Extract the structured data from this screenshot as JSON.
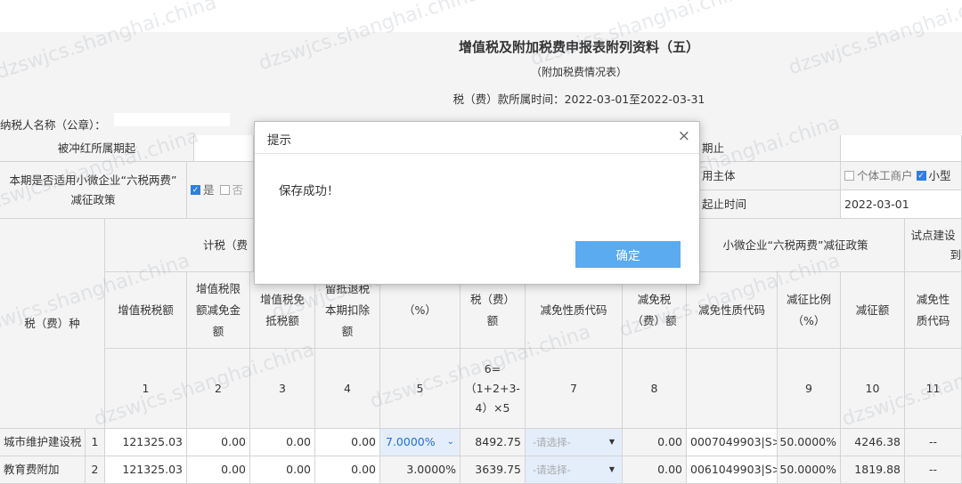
{
  "header": {
    "title": "增值税及附加税费申报表附列资料（五）",
    "subtitle": "（附加税费情况表）",
    "period": "税（费）款所属时间：2022-03-01至2022-03-31",
    "taxpayer_label": "纳税人名称（公章）："
  },
  "info": {
    "red_period_start_label": "被冲红所属期起",
    "red_period_end_label": "期止",
    "small_policy_label_1": "本期是否适用小微企业“六税两费”",
    "small_policy_label_2": "减征政策",
    "yes_label": "是",
    "no_label": "否",
    "subject_label": "用主体",
    "individual_label": "个体工商户",
    "small_label": "小型",
    "start_time_label": "起止时间",
    "start_time_value": "2022-03-01"
  },
  "columns": {
    "tax_type": "税（费）种",
    "calc_group": "计税（费",
    "small_group": "小微企业“六税两费”减征政策",
    "pilot_group": "试点建设",
    "pilot_group_2": "到",
    "vat_amount": "增值税税额",
    "limit_reduction": "增值税限额减免金额",
    "exempt_offset": "增值税免抵税额",
    "refund_deduction": "留抵退税本期扣除额",
    "rate": "（%）",
    "tax_amount": "税（费）额",
    "exempt_code": "减免性质代码",
    "exempt_amount": "减免税（费）额",
    "reduction_code": "减免性质代码",
    "reduction_ratio": "减征比例（%）",
    "reduction_amount": "减征额",
    "pilot_code": "减免性质代码"
  },
  "col_numbers": [
    "1",
    "2",
    "3",
    "4",
    "5",
    "6=（1+2+3-4）×5",
    "7",
    "8",
    "9",
    "10",
    "11"
  ],
  "rows": [
    {
      "name": "城市维护建设税",
      "no": "1",
      "vat": "121325.03",
      "limit": "0.00",
      "offset": "0.00",
      "refund": "0.00",
      "rate": "7.0000%",
      "tax": "8492.75",
      "exempt_code": "-请选择-",
      "exempt_amount": "0.00",
      "reduction_code": "0007049903|S>",
      "ratio": "50.0000%",
      "reduction": "4246.38",
      "pilot": "--"
    },
    {
      "name": "教育费附加",
      "no": "2",
      "vat": "121325.03",
      "limit": "0.00",
      "offset": "0.00",
      "refund": "0.00",
      "rate": "3.0000%",
      "tax": "3639.75",
      "exempt_code": "-请选择-",
      "exempt_amount": "0.00",
      "reduction_code": "0061049903|S>",
      "ratio": "50.0000%",
      "reduction": "1819.88",
      "pilot": "--"
    }
  ],
  "dialog": {
    "title": "提示",
    "close": "×",
    "message": "保存成功！",
    "ok": "确定"
  },
  "watermark": "dzswjcs.shanghai.china",
  "colors": {
    "background": "#f4f4f4",
    "border": "#d4d4d4",
    "accent": "#5aabf0",
    "checkbox": "#2f7fe0"
  }
}
